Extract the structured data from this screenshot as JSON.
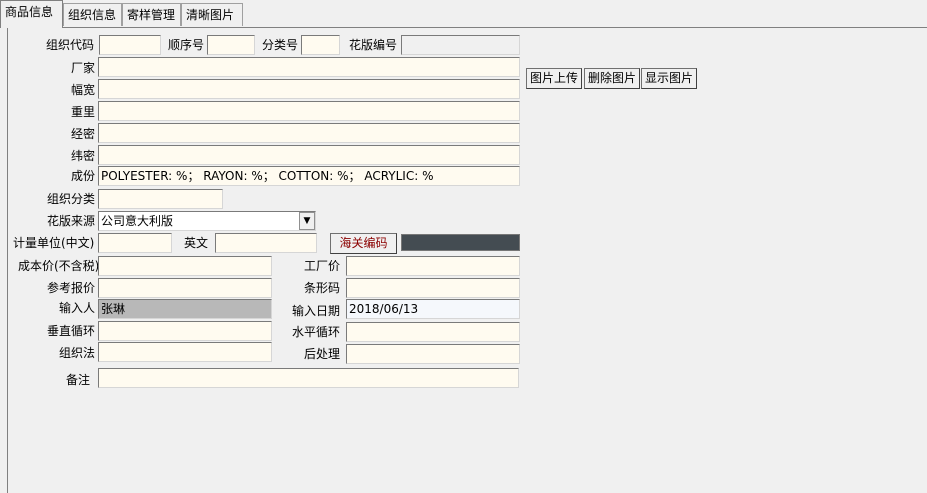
{
  "tabs": [
    "商品信息",
    "组织信息",
    "寄样管理",
    "清晰图片"
  ],
  "labels": {
    "org_code": "组织代码",
    "seq_no": "顺序号",
    "class_no": "分类号",
    "pattern_no": "花版编号",
    "manufacturer": "厂家",
    "width": "幅宽",
    "weight": "重里",
    "warp_density": "经密",
    "weft_density": "纬密",
    "composition": "成份",
    "org_category": "组织分类",
    "pattern_source": "花版来源",
    "unit_cn": "计量单位(中文)",
    "unit_en": "英文",
    "cost_price": "成本价(不含税)",
    "factory_price": "工厂价",
    "ref_price": "参考报价",
    "barcode": "条形码",
    "input_person": "输入人",
    "input_date": "输入日期",
    "vertical_repeat": "垂直循环",
    "horizontal_repeat": "水平循环",
    "weave": "组织法",
    "post_process": "后处理",
    "remark": "备注"
  },
  "values": {
    "composition": "POLYESTER:  %；  RAYON:  %；  COTTON:  %；  ACRYLIC:  %",
    "pattern_source": "公司意大利版",
    "input_person": "张琳",
    "input_date": "2018/06/13"
  },
  "buttons": {
    "upload": "图片上传",
    "delete": "删除图片",
    "show": "显示图片",
    "customs": "海关编码"
  },
  "icons": {
    "dropdown": "chevron-down-icon"
  }
}
